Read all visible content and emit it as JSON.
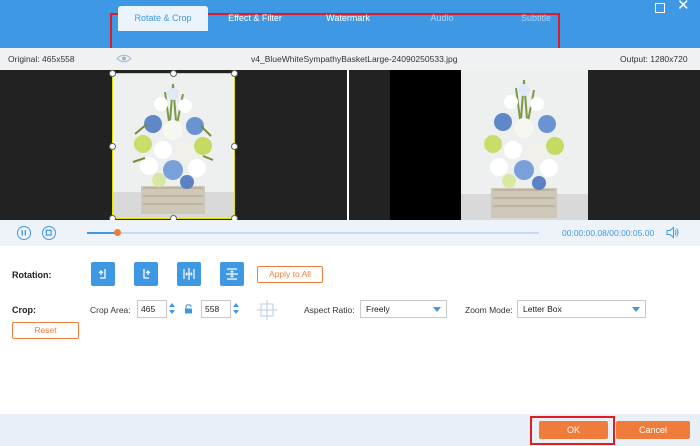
{
  "tabs": [
    {
      "label": "Rotate & Crop",
      "active": true
    },
    {
      "label": "Effect & Filter",
      "active": false
    },
    {
      "label": "Watermark",
      "active": false
    },
    {
      "label": "Audio",
      "active": false,
      "disabled": true
    },
    {
      "label": "Subtitle",
      "active": false,
      "disabled": true
    }
  ],
  "info": {
    "original": "Original: 465x558",
    "filename": "v4_BlueWhiteSympathyBasketLarge-24090250533.jpg",
    "output": "Output: 1280x720"
  },
  "playback": {
    "current_time": "00:00:00.08",
    "total_time": "/00:00:05.00",
    "progress": 0.066
  },
  "rotation": {
    "label": "Rotation:",
    "buttons": [
      "rotate-left-icon",
      "rotate-right-icon",
      "flip-horizontal-icon",
      "flip-vertical-icon"
    ],
    "apply_label": "Apply to All"
  },
  "crop": {
    "label": "Crop:",
    "area_label": "Crop Area:",
    "width": "465",
    "height": "558",
    "aspect_label": "Aspect Ratio:",
    "aspect_value": "Freely",
    "zoom_label": "Zoom Mode:",
    "zoom_value": "Letter Box",
    "reset_label": "Reset"
  },
  "footer": {
    "ok_label": "OK",
    "cancel_label": "Cancel"
  },
  "colors": {
    "accent": "#3f98e4",
    "orange": "#f07c3c",
    "highlight": "#e01b24"
  }
}
